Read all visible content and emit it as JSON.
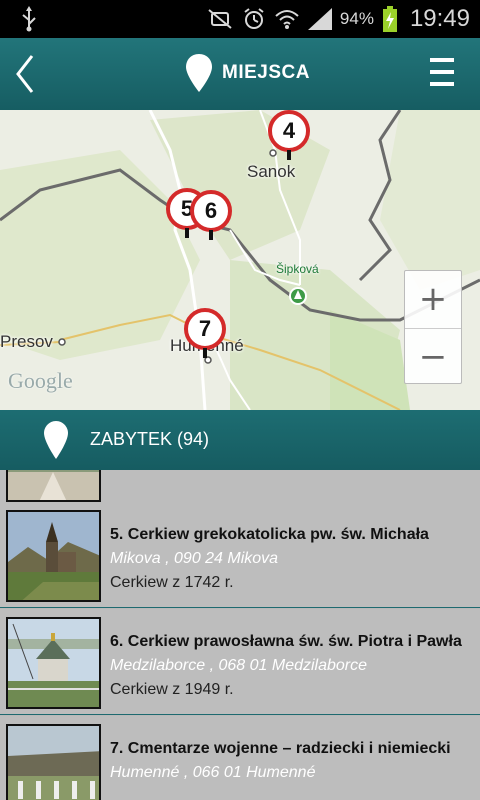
{
  "status_bar": {
    "battery_percent": "94%",
    "time": "19:49",
    "icons": [
      "usb-icon",
      "mute-icon",
      "alarm-icon",
      "wifi-icon",
      "signal-icon",
      "battery-charging-icon"
    ]
  },
  "header": {
    "title": "MIEJSCA",
    "back_icon": "chevron-left-icon",
    "menu_icon": "hamburger-menu-icon"
  },
  "map": {
    "markers": [
      {
        "label": "4"
      },
      {
        "label": "5"
      },
      {
        "label": "6"
      },
      {
        "label": "7"
      }
    ],
    "places": {
      "sanok": "Sanok",
      "sipkova": "Šipková",
      "presov": "Presov",
      "humenne": "Humenné"
    },
    "attribution": "Google",
    "zoom_in": "+",
    "zoom_out": "−"
  },
  "category": {
    "label": "ZABYTEK (94)"
  },
  "list": [
    {
      "title": "5. Cerkiew grekokatolicka pw. św. Michała",
      "address": "Mikova , 090 24 Mikova",
      "description": "Cerkiew z 1742 r."
    },
    {
      "title": "6. Cerkiew prawosławna św. św. Piotra i Pawła",
      "address": "Medzilaborce , 068 01 Medzilaborce",
      "description": "Cerkiew z 1949 r."
    },
    {
      "title": "7. Cmentarze wojenne – radziecki i niemiecki",
      "address": "Humenné , 066 01 Humenné",
      "description": ""
    }
  ],
  "colors": {
    "header": "#1b6a6f",
    "marker_ring": "#d42a2a",
    "list_bg": "#bdbdbd"
  }
}
